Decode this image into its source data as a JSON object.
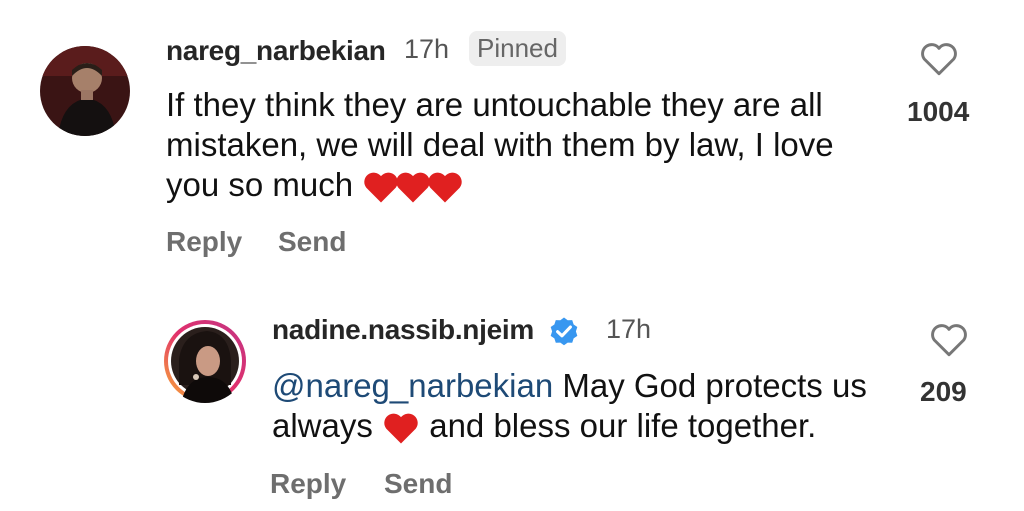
{
  "comments": [
    {
      "username": "nareg_narbekian",
      "time": "17h",
      "pinned_label": "Pinned",
      "text_lines": [
        "If they think they are untouchable they are all",
        "mistaken, we will deal with them by law, I love",
        "you so much"
      ],
      "like_count": "1004",
      "reply_label": "Reply",
      "send_label": "Send",
      "emoji": [
        "red-heart",
        "red-heart",
        "red-heart"
      ]
    },
    {
      "username": "nadine.nassib.njeim",
      "verified": true,
      "time": "17h",
      "mention": "@nareg_narbekian",
      "line1_rest": " May God protects us",
      "line2_before": "always",
      "line2_after": " and bless our life together.",
      "like_count": "209",
      "reply_label": "Reply",
      "send_label": "Send"
    }
  ],
  "colors": {
    "mention": "#1e4a76",
    "verified": "#3897f0",
    "heart": "#e02020"
  }
}
